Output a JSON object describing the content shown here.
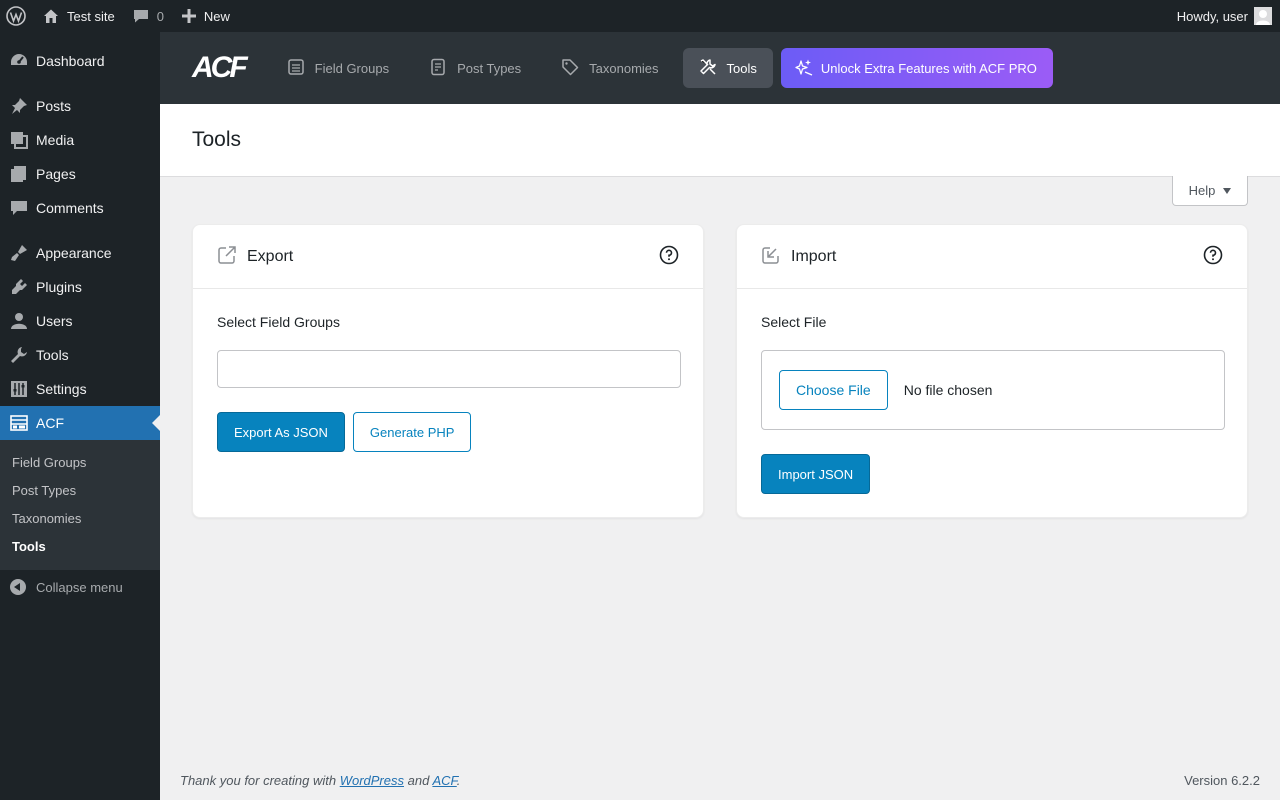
{
  "adminbar": {
    "site_name": "Test site",
    "comments_count": "0",
    "new_label": "New",
    "greeting": "Howdy, user"
  },
  "sidebar": {
    "items": [
      {
        "label": "Dashboard",
        "icon": "dashboard-icon"
      },
      {
        "label": "Posts",
        "icon": "pin-icon"
      },
      {
        "label": "Media",
        "icon": "media-icon"
      },
      {
        "label": "Pages",
        "icon": "pages-icon"
      },
      {
        "label": "Comments",
        "icon": "comment-icon"
      },
      {
        "label": "Appearance",
        "icon": "brush-icon"
      },
      {
        "label": "Plugins",
        "icon": "plugin-icon"
      },
      {
        "label": "Users",
        "icon": "user-icon"
      },
      {
        "label": "Tools",
        "icon": "wrench-icon"
      },
      {
        "label": "Settings",
        "icon": "settings-icon"
      },
      {
        "label": "ACF",
        "icon": "acf-icon"
      }
    ],
    "submenu": [
      "Field Groups",
      "Post Types",
      "Taxonomies",
      "Tools"
    ],
    "collapse_label": "Collapse menu"
  },
  "acf_header": {
    "logo": "ACF",
    "tabs": [
      "Field Groups",
      "Post Types",
      "Taxonomies",
      "Tools"
    ],
    "active_tab": "Tools",
    "pro_label": "Unlock Extra Features with ACF PRO"
  },
  "page": {
    "title": "Tools",
    "help_label": "Help"
  },
  "export": {
    "title": "Export",
    "select_label": "Select Field Groups",
    "export_json_label": "Export As JSON",
    "generate_php_label": "Generate PHP"
  },
  "import": {
    "title": "Import",
    "select_label": "Select File",
    "choose_file_label": "Choose File",
    "no_file_label": "No file chosen",
    "import_json_label": "Import JSON"
  },
  "footer": {
    "thanks_prefix": "Thank you for creating with ",
    "wordpress_link": "WordPress",
    "and": " and ",
    "acf_link": "ACF",
    "period": ".",
    "version": "Version 6.2.2"
  },
  "colors": {
    "admin_dark": "#1d2327",
    "active_blue": "#2271b1",
    "acf_blue": "#0783be",
    "pro_gradient_start": "#6c5cf6",
    "pro_gradient_end": "#9b5cf6"
  }
}
